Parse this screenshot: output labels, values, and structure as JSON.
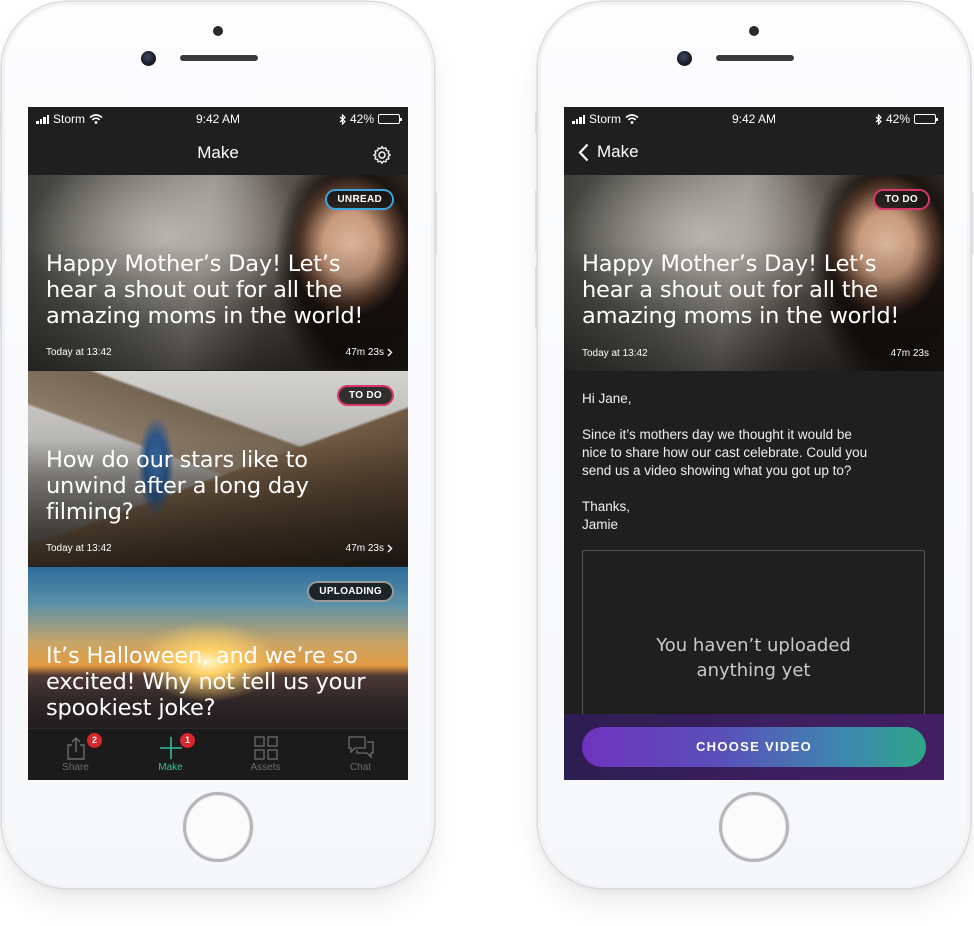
{
  "status_bar": {
    "carrier": "Storm",
    "time": "9:42 AM",
    "battery": "42%"
  },
  "left_screen": {
    "nav_title": "Make",
    "cards": [
      {
        "title": "Happy Mother’s Day! Let’s\nhear a shout out for all the\namazing moms in the world!",
        "badge": "UNREAD",
        "date": "Today at 13:42",
        "duration": "47m 23s"
      },
      {
        "title": "How do our stars like to\nunwind after a long day\nfilming?",
        "badge": "TO DO",
        "date": "Today at 13:42",
        "duration": "47m 23s"
      },
      {
        "title": "It’s Halloween, and we’re so\nexcited! Why not tell us your\nspookiest joke?",
        "badge": "UPLOADING"
      }
    ],
    "tabs": [
      {
        "label": "Share",
        "count": "2"
      },
      {
        "label": "Make",
        "count": "1"
      },
      {
        "label": "Assets"
      },
      {
        "label": "Chat"
      }
    ]
  },
  "right_screen": {
    "back_label": "Make",
    "card": {
      "title": "Happy Mother’s Day! Let’s\nhear a shout out for all the\namazing moms in the world!",
      "badge": "TO DO",
      "date": "Today at 13:42",
      "duration": "47m 23s"
    },
    "message": {
      "greeting": "Hi Jane,",
      "body": "Since it’s mothers day we thought it would be\nnice to share how our cast celebrate. Could you\nsend us a video showing what you got up to?",
      "signoff": "Thanks,\nJamie"
    },
    "empty_state": "You haven’t uploaded\nanything yet",
    "cta_label": "CHOOSE VIDEO"
  },
  "colors": {
    "unread_badge": "#3aa6e0",
    "todo_badge": "#d9356b",
    "uploading_badge": "#9a9a9a",
    "active_tab": "#35c09a",
    "tab_count": "#d7262c"
  },
  "icons": [
    "wifi-icon",
    "bluetooth-icon",
    "gear-icon",
    "chevron-right-icon",
    "back-chevron-icon",
    "share-icon",
    "plus-icon",
    "grid-icon",
    "chat-icon"
  ]
}
